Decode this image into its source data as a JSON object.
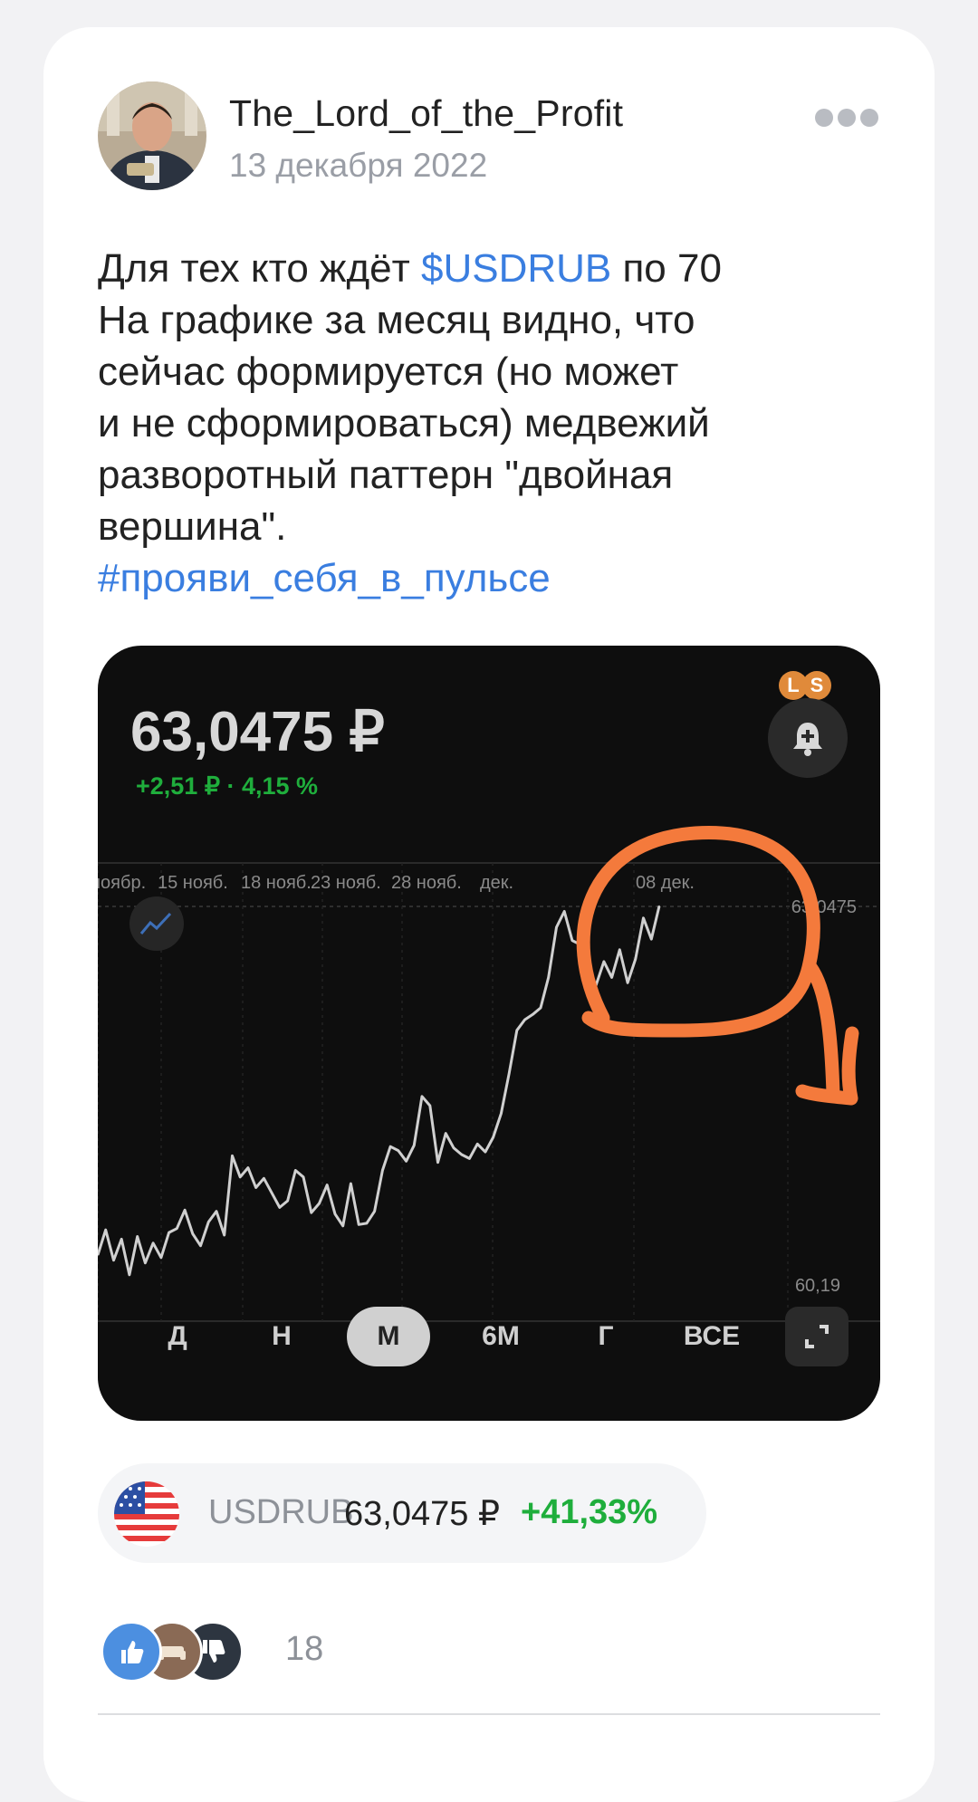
{
  "post": {
    "author": "The_Lord_of_the_Profit",
    "date": "13 декабря 2022",
    "text": {
      "line1_prefix": "Для тех кто ждёт ",
      "line1_ticker": "$USDRUB",
      "line1_suffix": " по 70",
      "line2": "На графике за месяц видно, что",
      "line3": "сейчас формируется (но может",
      "line4": "и не сформироваться) медвежий",
      "line5": "разворотный паттерн \"двойная",
      "line6": "вершина\".",
      "hashtag": "#прояви_себя_в_пульсе"
    }
  },
  "chart": {
    "price": "63,0475 ₽",
    "change": "+2,51 ₽ · 4,15 %",
    "badges": [
      "L",
      "S"
    ],
    "max_label": "63,0475",
    "min_label": "60,19",
    "timeframes": [
      "Д",
      "Н",
      "М",
      "6М",
      "Г",
      "ВСЕ"
    ],
    "active_timeframe": "М"
  },
  "chart_data": {
    "type": "line",
    "x_tick_labels": [
      "ноябр.",
      "15 нояб.",
      "18 нояб.",
      "23 нояб.",
      "28 нояб.",
      "дек.",
      "08 дек."
    ],
    "ylim": [
      60.19,
      63.0475
    ],
    "series": [
      {
        "values": [
          60.41,
          60.6,
          60.37,
          60.53,
          60.26,
          60.55,
          60.35,
          60.5,
          60.39,
          60.58,
          60.61,
          60.75,
          60.57,
          60.48,
          60.66,
          60.74,
          60.56,
          61.16,
          61.0,
          61.07,
          60.92,
          60.99,
          60.88,
          60.77,
          60.82,
          61.05,
          61.0,
          60.73,
          60.8,
          60.94,
          60.72,
          60.63,
          60.95,
          60.64,
          60.65,
          60.74,
          61.05,
          61.23,
          61.2,
          61.12,
          61.24,
          61.61,
          61.54,
          61.11,
          61.33,
          61.22,
          61.17,
          61.14,
          61.25,
          61.19,
          61.3,
          61.48,
          61.78,
          62.11,
          62.19,
          62.23,
          62.28,
          62.51,
          62.89,
          63.01,
          62.79,
          62.76,
          62.51,
          62.45,
          62.63,
          62.51,
          62.72,
          62.47,
          62.65,
          62.96,
          62.8,
          63.05
        ]
      }
    ],
    "grid": true
  },
  "ticker": {
    "symbol": "USDRUB",
    "price": "63,0475 ₽",
    "change": "+41,33%"
  },
  "reactions": {
    "count": "18",
    "icons": [
      "thumbs-up-icon",
      "sofa-icon",
      "thumbs-down-icon"
    ]
  },
  "colors": {
    "accent_link": "#3a7ee0",
    "positive": "#1fae3c",
    "annotation": "#f47a3c",
    "chart_bg": "#0e0e0e"
  }
}
